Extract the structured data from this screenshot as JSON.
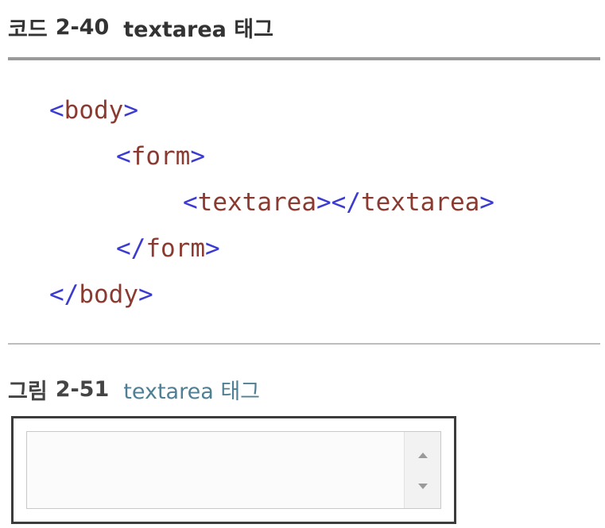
{
  "code_caption": {
    "prefix": "코드",
    "number": "2-40",
    "title": "textarea 태그"
  },
  "code_lines": [
    {
      "open": "<",
      "tag": "body",
      "close": ">"
    },
    {
      "open": "<",
      "tag": "form",
      "close": ">"
    },
    {
      "open": "<",
      "tag": "textarea",
      "mid": "></",
      "tag2": "textarea",
      "close": ">"
    },
    {
      "open": "</",
      "tag": "form",
      "close": ">"
    },
    {
      "open": "</",
      "tag": "body",
      "close": ">"
    }
  ],
  "figure_caption": {
    "prefix": "그림",
    "number": "2-51",
    "title": "textarea 태그"
  },
  "textarea_demo": {
    "value": ""
  },
  "colors": {
    "bracket": "#3b3bd0",
    "tag": "#8a3a30",
    "figure_title": "#4f7f94"
  },
  "icons": {
    "scroll_up": "scroll-up-arrow-icon",
    "scroll_down": "scroll-down-arrow-icon"
  }
}
